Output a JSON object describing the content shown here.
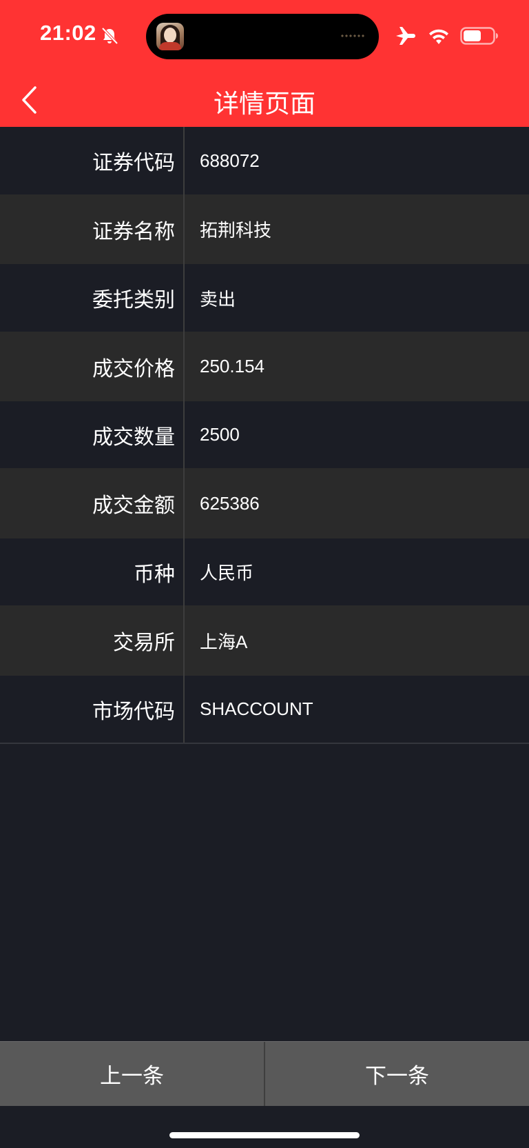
{
  "status_bar": {
    "time": "21:02",
    "icons": [
      "bell-slash-icon",
      "airplane-icon",
      "wifi-icon",
      "battery-icon"
    ]
  },
  "nav": {
    "title": "详情页面",
    "back_icon": "chevron-left-icon"
  },
  "details": [
    {
      "label": "证券代码",
      "value": "688072"
    },
    {
      "label": "证券名称",
      "value": "拓荆科技"
    },
    {
      "label": "委托类别",
      "value": "卖出"
    },
    {
      "label": "成交价格",
      "value": "250.154"
    },
    {
      "label": "成交数量",
      "value": "2500"
    },
    {
      "label": "成交金额",
      "value": "625386"
    },
    {
      "label": "币种",
      "value": "人民币"
    },
    {
      "label": "交易所",
      "value": "上海A"
    },
    {
      "label": "市场代码",
      "value": "SHACCOUNT"
    }
  ],
  "footer": {
    "prev_label": "上一条",
    "next_label": "下一条"
  },
  "colors": {
    "header_red": "#ff3333",
    "background": "#1b1d25",
    "row_alt": "#2a2a2a",
    "button_bg": "#595959"
  }
}
